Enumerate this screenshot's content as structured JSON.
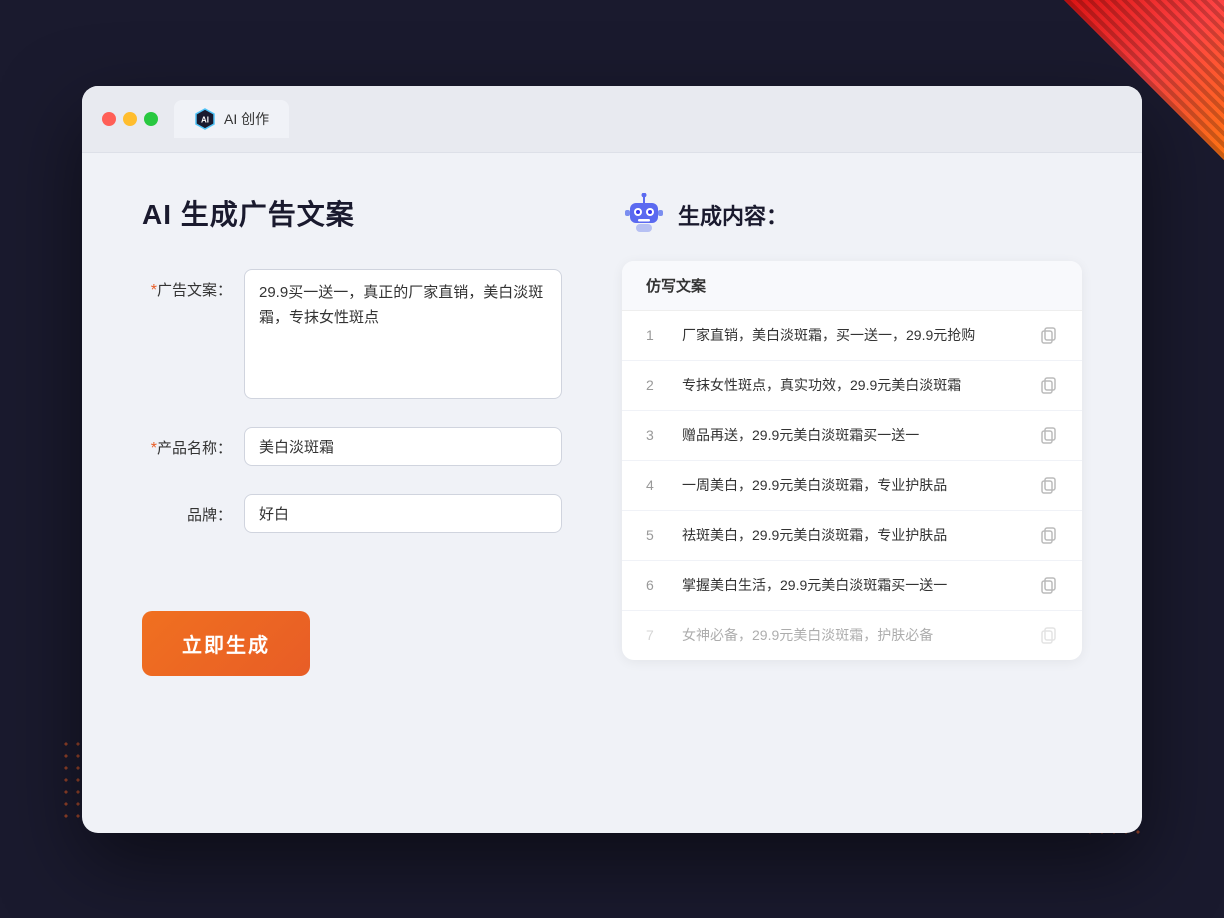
{
  "browser": {
    "tab_label": "AI 创作"
  },
  "page": {
    "title": "AI 生成广告文案",
    "right_title": "生成内容："
  },
  "form": {
    "ad_copy_label": "广告文案：",
    "ad_copy_required": "*",
    "ad_copy_value": "29.9买一送一，真正的厂家直销，美白淡斑霜，专抹女性斑点",
    "product_name_label": "产品名称：",
    "product_name_required": "*",
    "product_name_value": "美白淡斑霜",
    "brand_label": "品牌：",
    "brand_value": "好白",
    "generate_btn": "立即生成"
  },
  "results": {
    "column_label": "仿写文案",
    "items": [
      {
        "num": "1",
        "text": "厂家直销，美白淡斑霜，买一送一，29.9元抢购",
        "faded": false
      },
      {
        "num": "2",
        "text": "专抹女性斑点，真实功效，29.9元美白淡斑霜",
        "faded": false
      },
      {
        "num": "3",
        "text": "赠品再送，29.9元美白淡斑霜买一送一",
        "faded": false
      },
      {
        "num": "4",
        "text": "一周美白，29.9元美白淡斑霜，专业护肤品",
        "faded": false
      },
      {
        "num": "5",
        "text": "祛斑美白，29.9元美白淡斑霜，专业护肤品",
        "faded": false
      },
      {
        "num": "6",
        "text": "掌握美白生活，29.9元美白淡斑霜买一送一",
        "faded": false
      },
      {
        "num": "7",
        "text": "女神必备，29.9元美白淡斑霜，护肤必备",
        "faded": true
      }
    ]
  }
}
